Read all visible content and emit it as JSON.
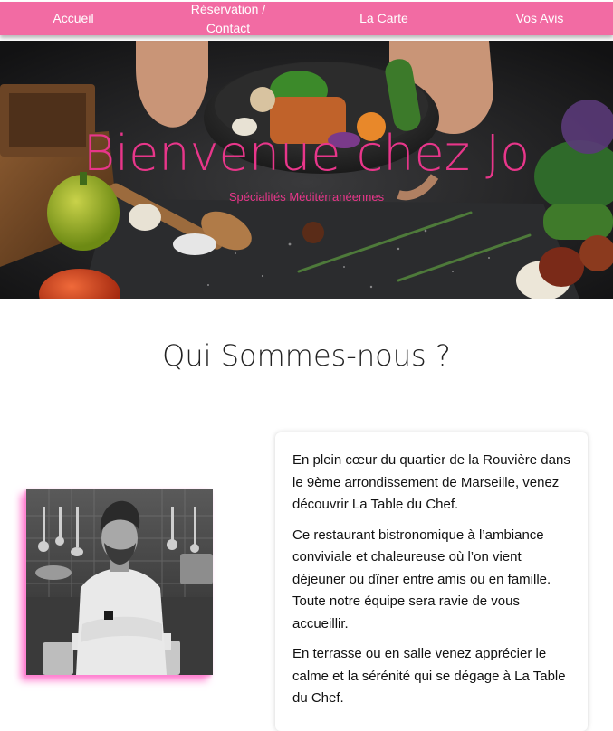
{
  "nav": {
    "items": [
      {
        "label": "Accueil"
      },
      {
        "label": "Réservation / Contact"
      },
      {
        "label": "La Carte"
      },
      {
        "label": "Vos Avis"
      }
    ]
  },
  "hero": {
    "title": "Bienvenue chez Jo",
    "subtitle": "Spécialités Méditérranéennes",
    "image": "food-preparation-photo"
  },
  "about": {
    "title": "Qui Sommes-nous ?",
    "image": "chef-photo",
    "paragraphs": [
      "En plein cœur du quartier de la Rouvière dans le 9ème arrondissement de Marseille, venez découvrir La Table du Chef.",
      "Ce restaurant bistronomique à l’ambiance conviviale et chaleureuse où l’on vient déjeuner ou dîner entre amis ou en famille. Toute notre équipe sera ravie de vous accueillir.",
      "En terrasse ou en salle venez apprécier le calme et la sérénité qui se dégage à La Table du Chef."
    ]
  },
  "colors": {
    "accent": "#f26ba3",
    "title_pink": "#e8368a",
    "glow": "#ff7fd0"
  }
}
